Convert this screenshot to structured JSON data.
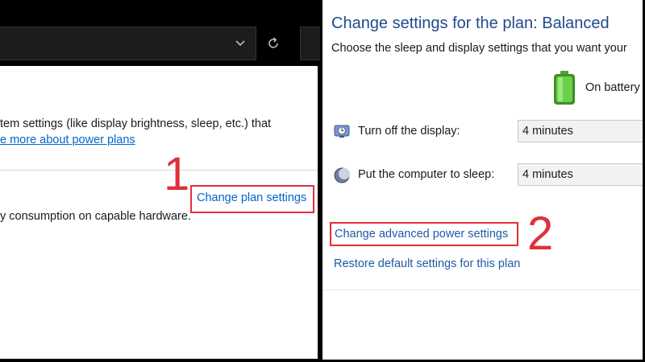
{
  "left": {
    "description_line": "tem settings (like display brightness, sleep, etc.) that",
    "learn_more_link": "e more about power plans",
    "consumption_text": "y consumption on capable hardware.",
    "change_plan_link": "Change plan settings",
    "step_marker": "1"
  },
  "right": {
    "title": "Change settings for the plan: Balanced",
    "subtitle": "Choose the sleep and display settings that you want your",
    "battery_column_label": "On battery",
    "rows": [
      {
        "label": "Turn off the display:",
        "value": "4 minutes",
        "icon": "display-clock-icon"
      },
      {
        "label": "Put the computer to sleep:",
        "value": "4 minutes",
        "icon": "sleep-moon-icon"
      }
    ],
    "advanced_link": "Change advanced power settings",
    "step_marker": "2",
    "restore_link": "Restore default settings for this plan"
  },
  "colors": {
    "highlight": "#e0303a",
    "link": "#0066cc",
    "title": "#1e4a8c",
    "battery": "#4caf2a"
  }
}
